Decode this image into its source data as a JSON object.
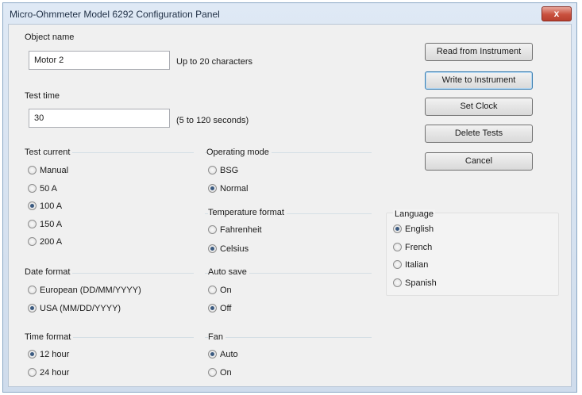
{
  "window": {
    "title": "Micro-Ohmmeter Model 6292 Configuration Panel",
    "close_glyph": "x"
  },
  "object_name": {
    "label": "Object name",
    "value": "Motor 2",
    "hint": "Up to 20 characters"
  },
  "test_time": {
    "label": "Test time",
    "value": "30",
    "hint": "(5 to 120 seconds)"
  },
  "buttons": {
    "read": "Read from Instrument",
    "write": "Write to Instrument",
    "set_clock": "Set Clock",
    "delete_tests": "Delete Tests",
    "cancel": "Cancel"
  },
  "test_current": {
    "label": "Test current",
    "options": [
      "Manual",
      "50 A",
      "100 A",
      "150 A",
      "200 A"
    ],
    "selected": "100 A"
  },
  "operating_mode": {
    "label": "Operating mode",
    "options": [
      "BSG",
      "Normal"
    ],
    "selected": "Normal"
  },
  "temperature_format": {
    "label": "Temperature format",
    "options": [
      "Fahrenheit",
      "Celsius"
    ],
    "selected": "Celsius"
  },
  "date_format": {
    "label": "Date format",
    "options": [
      "European (DD/MM/YYYY)",
      "USA (MM/DD/YYYY)"
    ],
    "selected": "USA (MM/DD/YYYY)"
  },
  "auto_save": {
    "label": "Auto save",
    "options": [
      "On",
      "Off"
    ],
    "selected": "Off"
  },
  "time_format": {
    "label": "Time format",
    "options": [
      "12 hour",
      "24 hour"
    ],
    "selected": "12 hour"
  },
  "fan": {
    "label": "Fan",
    "options": [
      "Auto",
      "On"
    ],
    "selected": "Auto"
  },
  "language": {
    "label": "Language",
    "options": [
      "English",
      "French",
      "Italian",
      "Spanish"
    ],
    "selected": "English"
  }
}
